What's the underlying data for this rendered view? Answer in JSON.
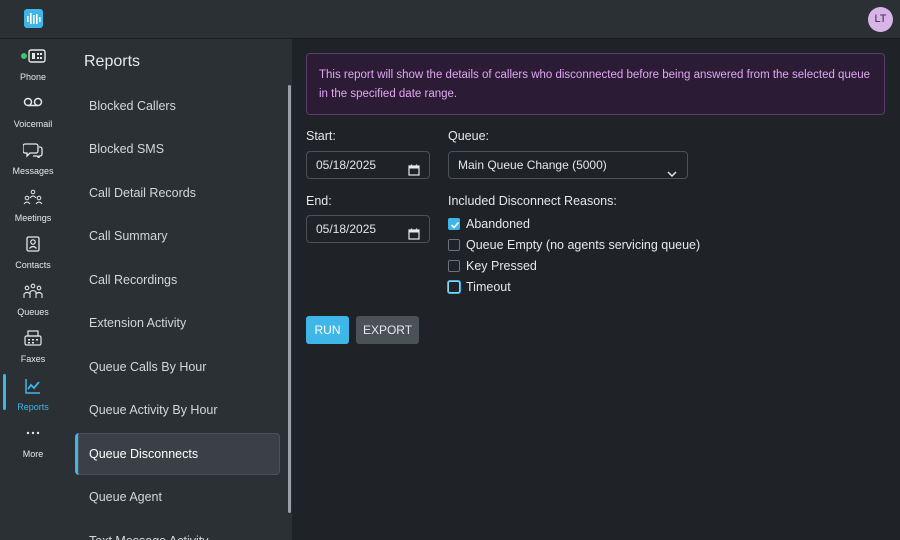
{
  "topbar": {
    "avatar_initials": "LT"
  },
  "rail": {
    "items": [
      {
        "label": "Phone",
        "icon": "phone-icon"
      },
      {
        "label": "Voicemail",
        "icon": "voicemail-icon"
      },
      {
        "label": "Messages",
        "icon": "messages-icon"
      },
      {
        "label": "Meetings",
        "icon": "meetings-icon"
      },
      {
        "label": "Contacts",
        "icon": "contacts-icon"
      },
      {
        "label": "Queues",
        "icon": "queues-icon"
      },
      {
        "label": "Faxes",
        "icon": "fax-icon"
      },
      {
        "label": "Reports",
        "icon": "reports-icon",
        "active": true
      },
      {
        "label": "More",
        "icon": "more-icon"
      }
    ]
  },
  "sidebar": {
    "title": "Reports",
    "items": [
      {
        "label": "Blocked Callers"
      },
      {
        "label": "Blocked SMS"
      },
      {
        "label": "Call Detail Records"
      },
      {
        "label": "Call Summary"
      },
      {
        "label": "Call Recordings"
      },
      {
        "label": "Extension Activity"
      },
      {
        "label": "Queue Calls By Hour"
      },
      {
        "label": "Queue Activity By Hour"
      },
      {
        "label": "Queue Disconnects",
        "active": true
      },
      {
        "label": "Queue Agent"
      },
      {
        "label": "Text Message Activity"
      }
    ]
  },
  "main": {
    "banner": "This report will show the details of callers who disconnected before being answered from the selected queue in the specified date range.",
    "start_label": "Start:",
    "start_value": "05/18/2025",
    "end_label": "End:",
    "end_value": "05/18/2025",
    "queue_label": "Queue:",
    "queue_value": "Main Queue Change (5000)",
    "reasons_label": "Included Disconnect Reasons:",
    "reasons": [
      {
        "label": "Abandoned",
        "checked": true
      },
      {
        "label": "Queue Empty (no agents servicing queue)",
        "checked": false
      },
      {
        "label": "Key Pressed",
        "checked": false
      },
      {
        "label": "Timeout",
        "checked": false,
        "focused": true
      }
    ],
    "run_label": "RUN",
    "export_label": "EXPORT"
  },
  "colors": {
    "accent": "#3fb6e8",
    "banner_bg": "#2c1b34",
    "banner_text": "#e0a8f4",
    "avatar_bg": "#d8b4e8"
  }
}
